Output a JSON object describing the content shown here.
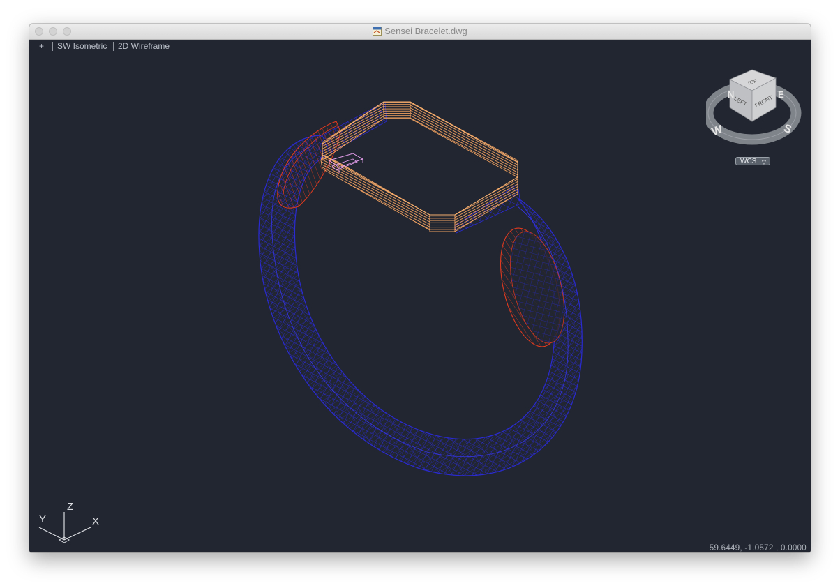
{
  "window": {
    "title": "Sensei Bracelet.dwg",
    "file_icon": "dwg-file-icon"
  },
  "viewport": {
    "plus": "+",
    "view": "SW Isometric",
    "visual_style": "2D Wireframe"
  },
  "viewcube": {
    "faces": {
      "top": "TOP",
      "left": "LEFT",
      "front": "FRONT"
    },
    "compass": {
      "n": "N",
      "e": "E",
      "w": "W",
      "s": "S"
    },
    "coordinate_system": "WCS"
  },
  "ucs_icon": {
    "x": "X",
    "y": "Y",
    "z": "Z"
  },
  "status": {
    "coordinates": "59.6449,  -1.0572 , 0.0000"
  },
  "colors": {
    "canvas": "#212630",
    "band_wireframe": "#2a2ad0",
    "clasp_wireframe": "#e03a20",
    "watch_face": "#f0a060",
    "connector": "#e8a0f0"
  }
}
